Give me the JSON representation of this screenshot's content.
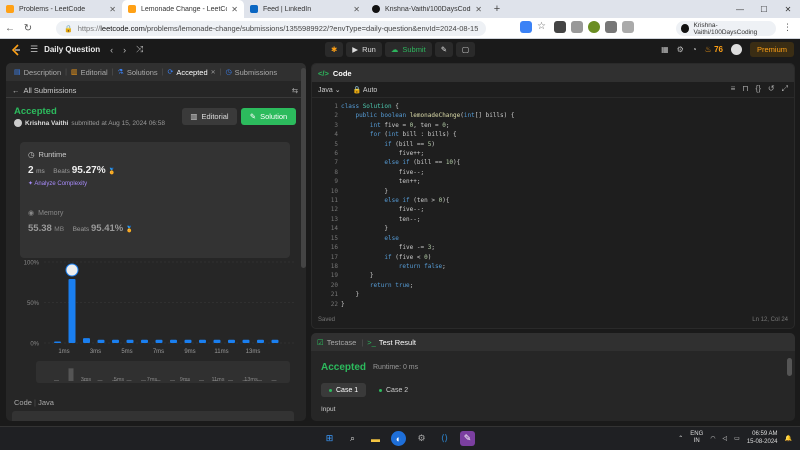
{
  "browser": {
    "tabs": [
      {
        "label": "Problems - LeetCode",
        "color": "#ffa116",
        "active": false
      },
      {
        "label": "Lemonade Change - LeetCode",
        "color": "#ffa116",
        "active": true
      },
      {
        "label": "Feed | LinkedIn",
        "color": "#0a66c2",
        "active": false
      },
      {
        "label": "Krishna-Vaithi/100DaysCoding",
        "color": "#111111",
        "active": false
      }
    ],
    "url_host": "leetcode.com",
    "url_path": "/problems/lemonade-change/submissions/1355989922/?envType=daily-question&envId=2024-08-15",
    "url_scheme": "https://",
    "github_box": "Krishna-Vaithi/100DaysCoding"
  },
  "header": {
    "title": "Daily Question",
    "run_label": "Run",
    "submit_label": "Submit",
    "streak": "76",
    "premium_label": "Premium"
  },
  "left": {
    "tabs": [
      "Description",
      "Editorial",
      "Solutions",
      "Accepted",
      "Submissions"
    ],
    "back_label": "All Submissions",
    "status": "Accepted",
    "author": "Krishna Vaithi",
    "submitted_text": "submitted at Aug 15, 2024 06:58",
    "editorial_btn": "Editorial",
    "solution_btn": "Solution",
    "runtime_label": "Runtime",
    "runtime_value": "2",
    "runtime_unit": "ms",
    "beats_label": "Beats",
    "runtime_beats": "95.27%",
    "analyze_label": "Analyze Complexity",
    "memory_label": "Memory",
    "memory_value": "55.38",
    "memory_unit": "MB",
    "memory_beats": "95.41%",
    "code_label": "Code",
    "code_lang": "Java"
  },
  "chart_data": {
    "type": "bar",
    "y_ticks": [
      "100%",
      "50%",
      "0%"
    ],
    "ylim": [
      0,
      100
    ],
    "x_ticks": [
      "1ms",
      "3ms",
      "5ms",
      "7ms",
      "9ms",
      "11ms",
      "13ms"
    ],
    "mini_x_ticks": [
      "3ms",
      "5ms",
      "7ms",
      "9ms",
      "11ms",
      "13ms"
    ],
    "values": [
      1,
      79,
      6,
      4,
      4,
      4,
      4,
      4,
      4,
      4,
      4,
      4,
      4,
      4,
      4,
      4
    ],
    "highlight_index": 1,
    "bar_color": "#1a7ff0"
  },
  "editor": {
    "title": "Code",
    "language": "Java",
    "auto_label": "Auto",
    "saved_label": "Saved",
    "cursor": "Ln 12, Col 24",
    "line_numbers": [
      "1",
      "2",
      "3",
      "4",
      "5",
      "6",
      "7",
      "8",
      "9",
      "10",
      "11",
      "12",
      "13",
      "14",
      "15",
      "16",
      "17",
      "18",
      "19",
      "20",
      "21",
      "22"
    ],
    "code_lines": [
      "class Solution {",
      "    public boolean lemonadeChange(int[] bills) {",
      "        int five = 0, ten = 0;",
      "        for (int bill : bills) {",
      "            if (bill == 5)",
      "                five++;",
      "            else if (bill == 10){",
      "                five--;",
      "                ten++;",
      "            }",
      "            else if (ten > 0){",
      "                five--;",
      "                ten--;",
      "            }",
      "            else",
      "                five -= 3;",
      "            if (five < 0)",
      "                return false;",
      "        }",
      "        return true;",
      "    }",
      "}"
    ]
  },
  "test": {
    "testcase_tab": "Testcase",
    "result_tab": "Test Result",
    "status": "Accepted",
    "runtime_text": "Runtime: 0 ms",
    "case1": "Case 1",
    "case2": "Case 2",
    "input_label": "Input"
  },
  "taskbar": {
    "lang_top": "ENG",
    "lang_bottom": "IN",
    "time": "06:59 AM",
    "date": "15-08-2024"
  }
}
